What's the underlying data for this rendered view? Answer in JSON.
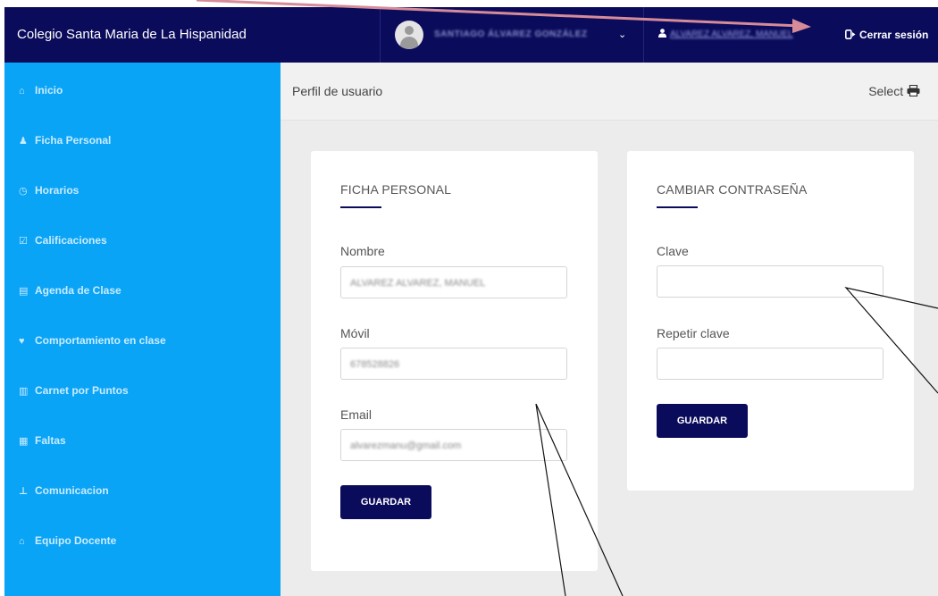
{
  "app": {
    "title": "Colegio Santa Maria de La Hispanidad"
  },
  "topbar": {
    "user_name": "SANTIAGO ÁLVAREZ GONZÁLEZ",
    "user_menu_chevron": "⌄",
    "profile_icon": "user-icon",
    "profile_name": "ALVAREZ ALVAREZ, MANUEL",
    "logout_label": "Cerrar sesión",
    "logout_icon": "sign-out-icon"
  },
  "sidebar": {
    "items": [
      {
        "label": "Inicio",
        "icon": "home-icon",
        "glyph": "⌂"
      },
      {
        "label": "Ficha Personal",
        "icon": "user-icon",
        "glyph": "♟"
      },
      {
        "label": "Horarios",
        "icon": "clock-icon",
        "glyph": "◷"
      },
      {
        "label": "Calificaciones",
        "icon": "check-square-icon",
        "glyph": "☑"
      },
      {
        "label": "Agenda de Clase",
        "icon": "briefcase-icon",
        "glyph": "▤"
      },
      {
        "label": "Comportamiento en clase",
        "icon": "heart-icon",
        "glyph": "♥"
      },
      {
        "label": "Carnet por Puntos",
        "icon": "bar-chart-icon",
        "glyph": "▥"
      },
      {
        "label": "Faltas",
        "icon": "calendar-icon",
        "glyph": "▦"
      },
      {
        "label": "Comunicacion",
        "icon": "pin-icon",
        "glyph": "⊥"
      },
      {
        "label": "Equipo Docente",
        "icon": "graduation-cap-icon",
        "glyph": "⌂"
      }
    ]
  },
  "main": {
    "page_title": "Perfil de usuario",
    "print_label": "Select",
    "print_icon": "print-icon"
  },
  "ficha": {
    "title": "FICHA PERSONAL",
    "nombre_label": "Nombre",
    "nombre_value": "ALVAREZ ALVAREZ, MANUEL",
    "movil_label": "Móvil",
    "movil_value": "678528826",
    "email_label": "Email",
    "email_value": "alvarezmanu@gmail.com",
    "save_label": "GUARDAR"
  },
  "password": {
    "title": "CAMBIAR CONTRASEÑA",
    "clave_label": "Clave",
    "clave_value": "",
    "repetir_label": "Repetir clave",
    "repetir_value": "",
    "save_label": "GUARDAR"
  },
  "colors": {
    "navy": "#0b0b5c",
    "sidebar": "#0aa4f6",
    "content_bg": "#ececec",
    "annotation_arrow": "#d68c98"
  }
}
